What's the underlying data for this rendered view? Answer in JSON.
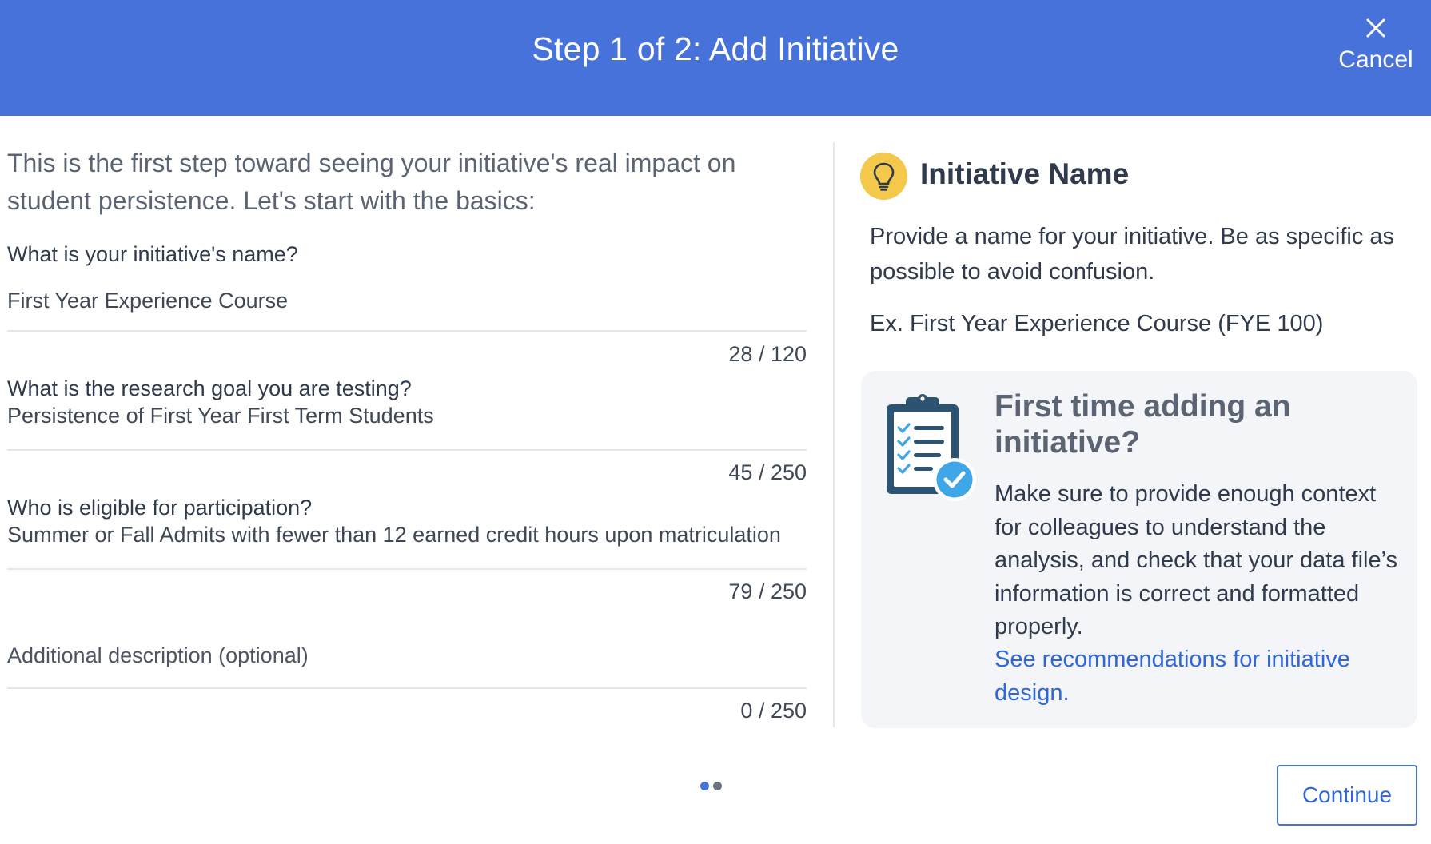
{
  "header": {
    "title": "Step 1 of 2: Add Initiative",
    "cancel_label": "Cancel"
  },
  "form": {
    "intro": "This is the first step toward seeing your initiative's real impact on student persistence. Let's start with the basics:",
    "fields": [
      {
        "label": "What is your initiative's name?",
        "value": "First Year Experience Course",
        "counter": "28 / 120"
      },
      {
        "label": "What is the research goal you are testing?",
        "value": "Persistence of First Year First Term Students",
        "counter": "45 / 250"
      },
      {
        "label": "Who is eligible for participation?",
        "value": "Summer or Fall Admits with fewer than 12 earned credit hours upon matriculation",
        "counter": "79 / 250"
      },
      {
        "placeholder": "Additional description (optional)",
        "value": "",
        "counter": "0 / 250"
      }
    ]
  },
  "help": {
    "icon": "lightbulb-icon",
    "title": "Initiative Name",
    "body": "Provide a name for your initiative. Be as specific as possible to avoid confusion.",
    "example": "Ex. First Year Experience Course (FYE 100)"
  },
  "tip": {
    "icon": "clipboard-checklist-icon",
    "title": "First time adding an initiative?",
    "body": "Make sure to provide enough context for colleagues to understand the analysis, and check that your data file’s information is correct and formatted properly.",
    "link": "See recommendations for initiative design."
  },
  "pager": {
    "total_steps": 2,
    "current_step": 1
  },
  "footer": {
    "continue_label": "Continue"
  },
  "colors": {
    "header_bg": "#4672da",
    "accent": "#2f66d9",
    "bulb": "#f4c84a",
    "card_bg": "#f3f5f9",
    "check_badge": "#3fa6e8"
  }
}
